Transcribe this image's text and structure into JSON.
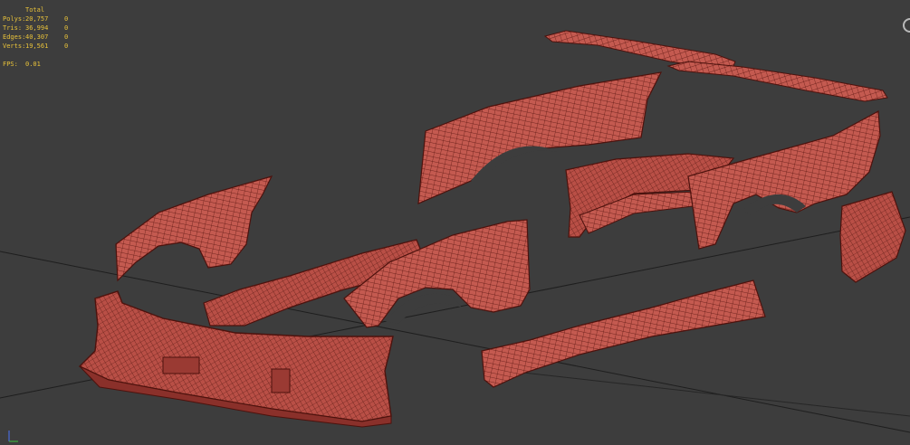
{
  "stats": {
    "header": "Total",
    "rows": [
      {
        "label": "Polys:",
        "total": "20,757",
        "selected": "0"
      },
      {
        "label": "Tris:",
        "total": "36,994",
        "selected": "0"
      },
      {
        "label": "Edges:",
        "total": "40,307",
        "selected": "0"
      },
      {
        "label": "Verts:",
        "total": "19,561",
        "selected": "0"
      }
    ],
    "fps_label": "FPS:",
    "fps_value": "0.01"
  },
  "colors": {
    "background": "#3d3d3d",
    "grid_line": "#1a1a1a",
    "mesh_fill": "#c45a50",
    "mesh_wire": "#5a1510",
    "stats_text": "#e8c23a"
  },
  "icons": {
    "nav_gizmo": "viewcube-ring-icon",
    "axis": "axis-tripod-icon"
  }
}
